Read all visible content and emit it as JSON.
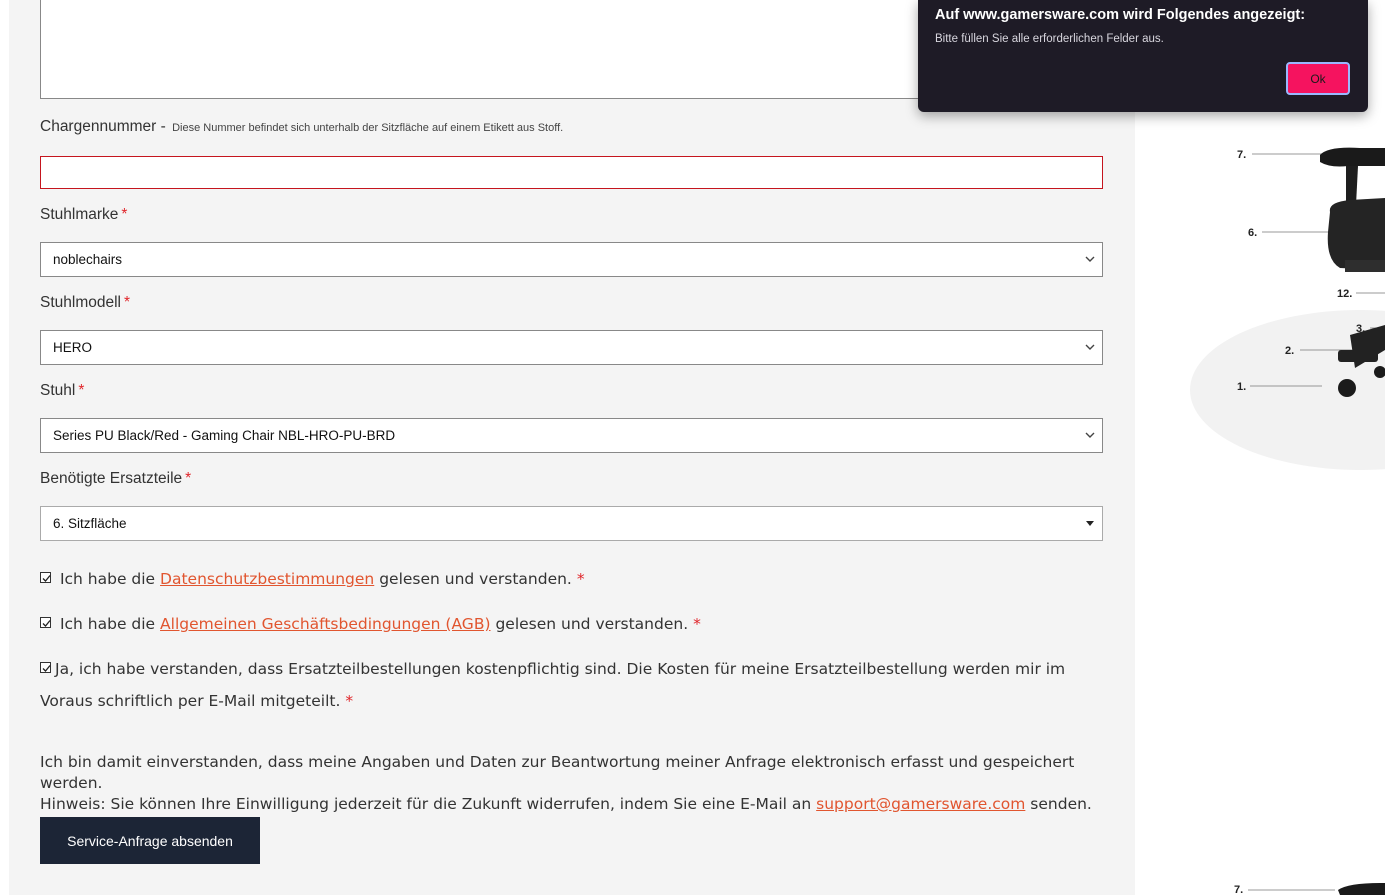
{
  "form": {
    "charge": {
      "label": "Chargennummer -",
      "hint": "Diese Nummer befindet sich unterhalb der Sitzfläche auf einem Etikett aus Stoff.",
      "value": ""
    },
    "brand": {
      "label": "Stuhlmarke",
      "required": "*",
      "value": "noblechairs"
    },
    "model": {
      "label": "Stuhlmodell",
      "required": "*",
      "value": "HERO"
    },
    "chair": {
      "label": "Stuhl",
      "required": "*",
      "value": "Series PU Black/Red - Gaming Chair NBL-HRO-PU-BRD"
    },
    "parts": {
      "label": "Benötigte Ersatzteile",
      "required": "*",
      "value": "6. Sitzfläche"
    },
    "privacy": {
      "before": "Ich habe die",
      "link": "Datenschutzbestimmungen",
      "after": "gelesen und verstanden.",
      "required": "*",
      "checked": true
    },
    "terms": {
      "before": "Ich habe die",
      "link": "Allgemeinen Geschäftsbedingungen (AGB)",
      "after": "gelesen und verstanden.",
      "required": "*",
      "checked": true
    },
    "costs": {
      "text": "Ja, ich habe verstanden, dass Ersatzteilbestellungen kostenpflichtig sind. Die Kosten für meine Ersatzteilbestellung werden mir im Voraus schriftlich per E-Mail mitgeteilt.",
      "required": "*",
      "checked": true
    },
    "consent": {
      "line1": "Ich bin damit einverstanden, dass meine Angaben und Daten zur Beantwortung meiner Anfrage elektronisch erfasst und gespeichert werden.",
      "line2_before": "Hinweis: Sie können Ihre Einwilligung jederzeit für die Zukunft widerrufen, indem Sie eine E-Mail an",
      "email": "support@gamersware.com",
      "line2_after": "senden."
    },
    "submit_label": "Service-Anfrage absenden"
  },
  "diagram": {
    "labels": [
      "7.",
      "6.",
      "12.",
      "3.",
      "2.",
      "1."
    ],
    "bottom_label": "7."
  },
  "dialog": {
    "title": "Auf www.gamersware.com wird Folgendes angezeigt:",
    "message": "Bitte füllen Sie alle erforderlichen Felder aus.",
    "ok_label": "Ok"
  },
  "colors": {
    "accent_link": "#e1552f",
    "required": "#e0262b",
    "error_border": "#c5151e",
    "submit_bg": "#1c2536",
    "dialog_bg": "#1e1b26",
    "ok_bg": "#f5135f"
  }
}
